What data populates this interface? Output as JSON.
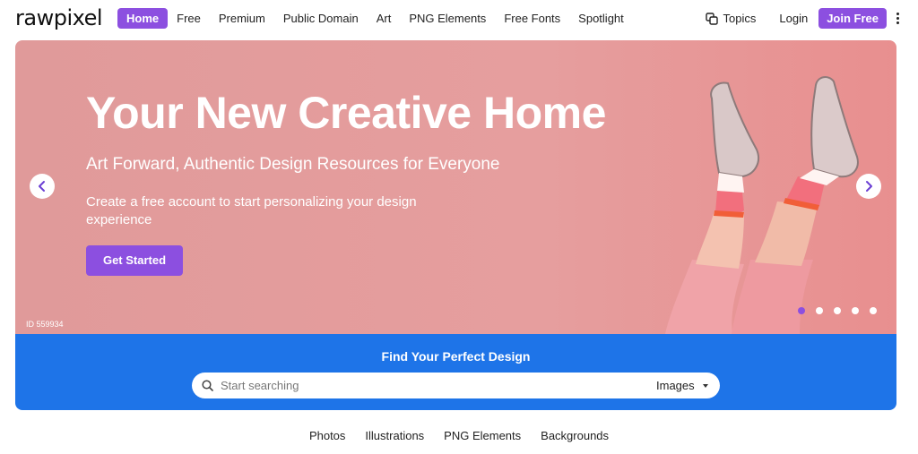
{
  "brand": {
    "logo_text": "rawpixel",
    "accent": "#8c4fe0",
    "blue": "#1e74e8"
  },
  "nav": {
    "links": [
      "Home",
      "Free",
      "Premium",
      "Public Domain",
      "Art",
      "PNG Elements",
      "Free Fonts",
      "Spotlight"
    ],
    "active": "Home",
    "topics_label": "Topics",
    "topics_icon": "topics-icon",
    "login_label": "Login",
    "join_label": "Join Free",
    "more_icon": "kebab-menu-icon"
  },
  "hero": {
    "title": "Your New Creative Home",
    "subtitle": "Art Forward, Authentic Design Resources for Everyone",
    "description": "Create a free account to start personalizing your design experience",
    "cta_label": "Get Started",
    "image_id": "ID 559934",
    "slide_count": 5,
    "active_slide": 1,
    "background": "#e69e9e",
    "prev_icon": "chevron-left-icon",
    "next_icon": "chevron-right-icon"
  },
  "search": {
    "heading": "Find Your Perfect Design",
    "placeholder": "Start searching",
    "value": "",
    "type_selected": "Images",
    "search_icon": "search-icon"
  },
  "category_tabs": [
    "Photos",
    "Illustrations",
    "PNG Elements",
    "Backgrounds"
  ]
}
